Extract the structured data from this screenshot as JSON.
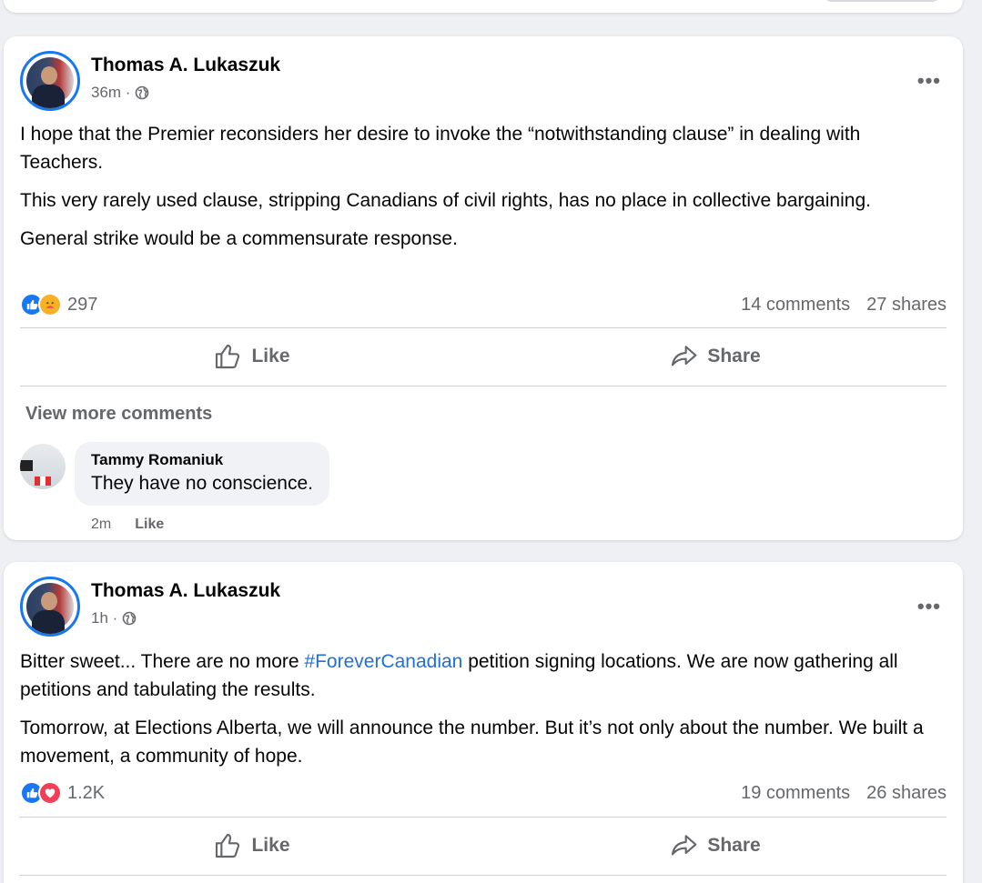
{
  "posts": [
    {
      "author": "Thomas A. Lukaszuk",
      "time": "36m ·",
      "paragraphs": [
        "I hope that the Premier reconsiders her desire to invoke the “notwithstanding clause” in dealing with Teachers.",
        "This very rarely used clause, stripping Canadians of civil rights, has no place in collective bargaining.",
        "General strike would be a commensurate response."
      ],
      "reaction_count": "297",
      "comments": "14 comments",
      "shares": "27 shares",
      "like_label": "Like",
      "share_label": "Share",
      "view_more_comments": "View more comments",
      "comment": {
        "author": "Tammy Romaniuk",
        "text": "They have no conscience.",
        "time": "2m",
        "like_label": "Like"
      }
    },
    {
      "author": "Thomas A. Lukaszuk",
      "time": "1h ·",
      "p1_before": "Bitter sweet... There are no more ",
      "p1_hashtag": "#ForeverCanadian",
      "p1_after": " petition signing locations. We are now gathering all petitions and tabulating the results.",
      "p2": "Tomorrow, at Elections Alberta, we will announce the number. But it’s not only about the number. We built a movement, a community of hope.",
      "reaction_count": "1.2K",
      "comments": "19 comments",
      "shares": "26 shares",
      "like_label": "Like",
      "share_label": "Share"
    }
  ],
  "colors": {
    "link_blue": "#216fdb",
    "like_blue": "#1877f2",
    "love_red": "#f33e58",
    "care_yellow": "#f7b125",
    "secondary_text": "#65676b"
  }
}
